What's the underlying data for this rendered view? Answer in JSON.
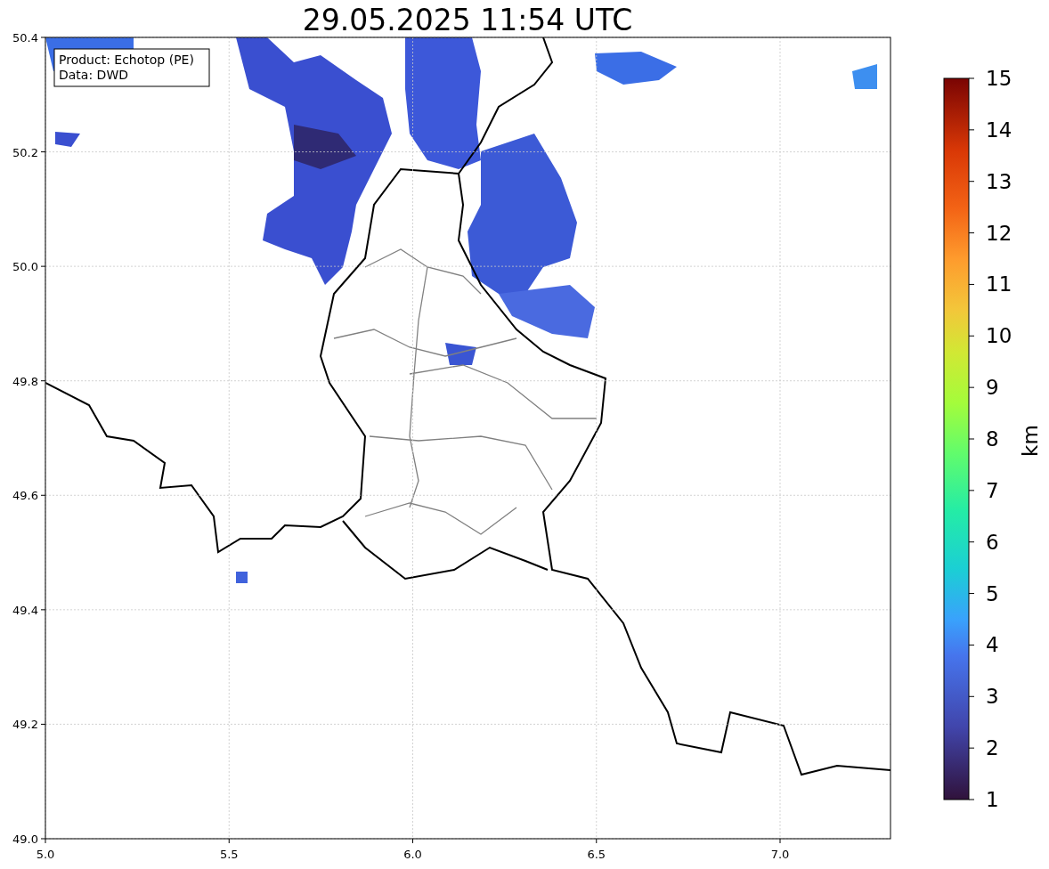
{
  "title": "29.05.2025 11:54 UTC",
  "legend": [
    "Product: Echotop (PE)",
    "Data: DWD"
  ],
  "x_axis": {
    "ticks": [
      "5.0",
      "5.5",
      "6.0",
      "6.5",
      "7.0"
    ]
  },
  "y_axis": {
    "ticks": [
      "50.4",
      "50.2",
      "50.0",
      "49.8",
      "49.6",
      "49.4",
      "49.2",
      "49.0"
    ]
  },
  "colorbar": {
    "label": "km",
    "ticks": [
      "15",
      "14",
      "13",
      "12",
      "11",
      "10",
      "9",
      "8",
      "7",
      "6",
      "5",
      "4",
      "3",
      "2",
      "1"
    ]
  }
}
